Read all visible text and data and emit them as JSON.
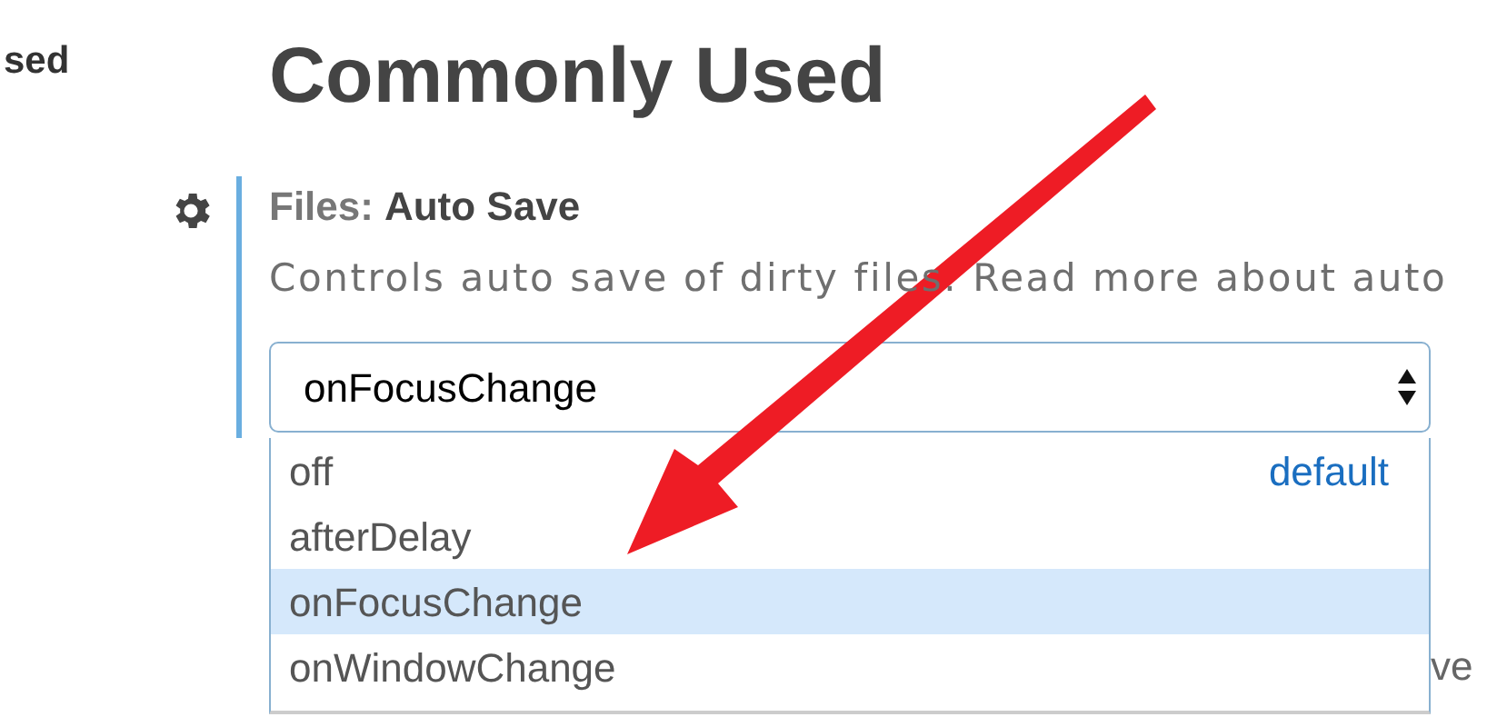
{
  "sidebar": {
    "item": "sed"
  },
  "section_title": "Commonly Used",
  "setting": {
    "category": "Files:",
    "name": "Auto Save",
    "description": "Controls auto save of dirty files. Read more about auto",
    "select": {
      "value": "onFocusChange",
      "expanded": true,
      "options": [
        {
          "label": "off",
          "selected": false,
          "badge": "default"
        },
        {
          "label": "afterDelay",
          "selected": false
        },
        {
          "label": "onFocusChange",
          "selected": true
        },
        {
          "label": "onWindowChange",
          "selected": false
        }
      ]
    }
  },
  "next_setting_fragment": "ve"
}
